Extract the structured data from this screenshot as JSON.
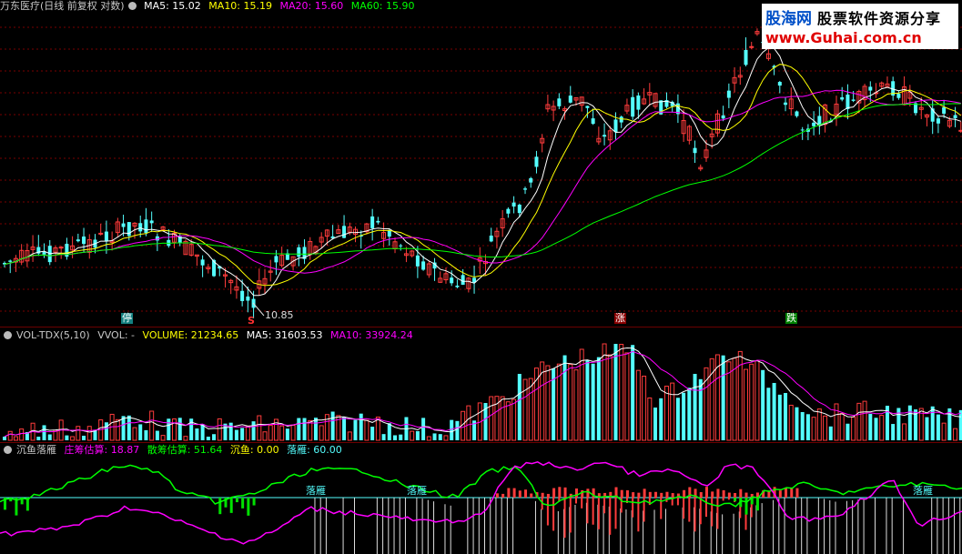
{
  "top_header": {
    "stock": "万东医疗(日线 前复权 对数)",
    "ma5": "MA5: 15.02",
    "ma10": "MA10: 15.19",
    "ma20": "MA20: 15.60",
    "ma60": "MA60: 15.90"
  },
  "vol_header": {
    "name": "VOL-TDX(5,10)",
    "vvol": "VVOL: -",
    "volume": "VOLUME: 21234.65",
    "ma5": "MA5: 31603.53",
    "ma10": "MA10: 33924.24"
  },
  "ind_header": {
    "name": "沉鱼落雁",
    "zhuang": "庄筹估算: 18.87",
    "san": "散筹估算: 51.64",
    "chenyu": "沉鱼: 0.00",
    "luoyan": "落雁: 60.00"
  },
  "logo": {
    "brand": "股海网",
    "slogan": "股票软件资源分享",
    "url": "www.Guhai.com.cn"
  },
  "markers": {
    "ting": "停",
    "s": "S",
    "low": "10.85",
    "zhang": "涨",
    "die": "跌",
    "luoyan1": "落雁",
    "luoyan2": "落雁",
    "luoyan3": "落雁"
  },
  "colors": {
    "up": "#ff3c3c",
    "down": "#54ffff",
    "ma5": "#ffffff",
    "ma10": "#ffff00",
    "ma20": "#ff00ff",
    "ma60": "#00ff00",
    "grid": "#7a0000"
  },
  "chart_data": [
    {
      "type": "candlestick",
      "title": "万东医疗(日线 前复权 对数)",
      "series": [
        "MA5",
        "MA10",
        "MA20",
        "MA60"
      ],
      "latest": {
        "MA5": 15.02,
        "MA10": 15.19,
        "MA20": 15.6,
        "MA60": 15.9
      },
      "annotations": [
        {
          "label": "10.85",
          "kind": "period-low"
        },
        {
          "label": "停"
        },
        {
          "label": "S"
        },
        {
          "label": "涨"
        },
        {
          "label": "跌"
        }
      ],
      "scale": "log",
      "grid": true
    },
    {
      "type": "bar",
      "title": "VOL-TDX(5,10)",
      "series": [
        "VOLUME",
        "MA5",
        "MA10"
      ],
      "latest": {
        "VOLUME": 21234.65,
        "MA5": 31603.53,
        "MA10": 33924.24
      }
    },
    {
      "type": "line",
      "title": "沉鱼落雁",
      "series": [
        "庄筹估算",
        "散筹估算",
        "沉鱼",
        "落雁"
      ],
      "latest": {
        "庄筹估算": 18.87,
        "散筹估算": 51.64,
        "沉鱼": 0.0,
        "落雁": 60.0
      }
    }
  ]
}
